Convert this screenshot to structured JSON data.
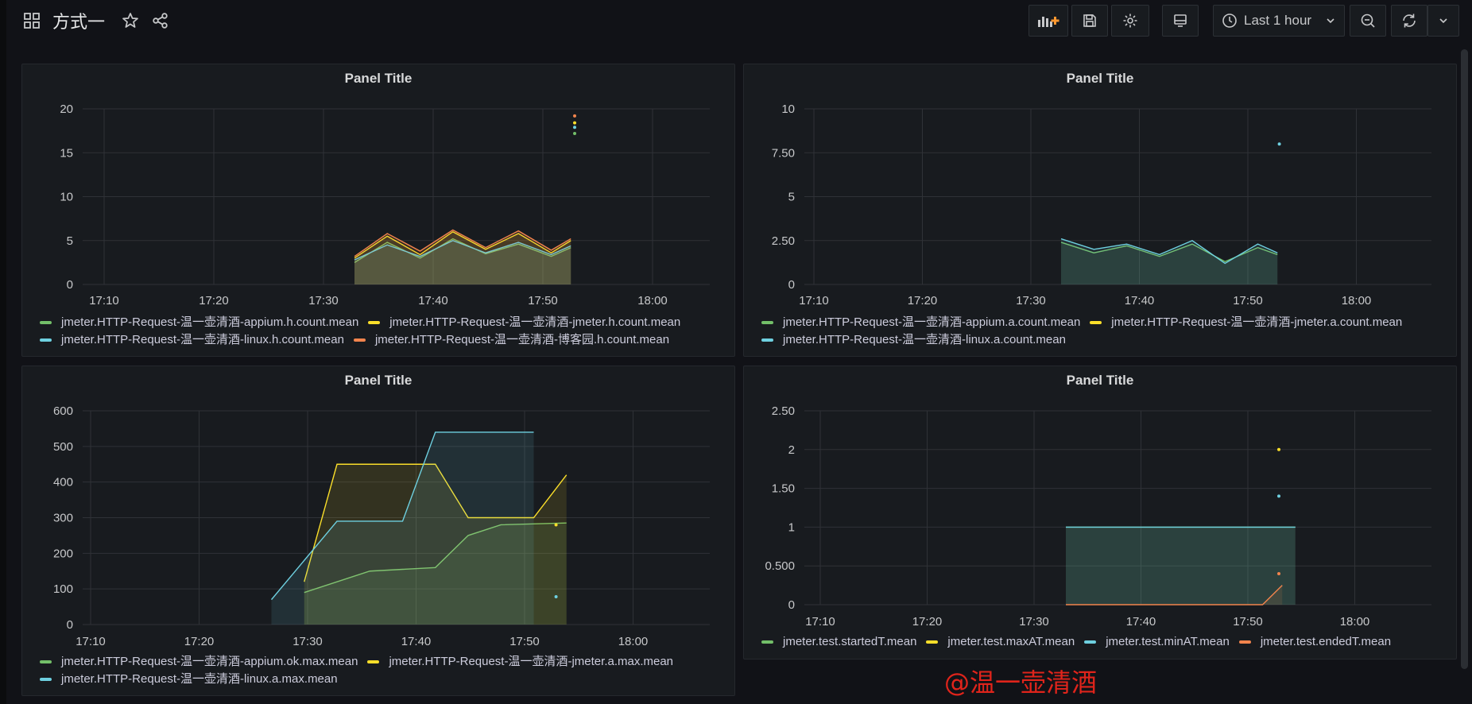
{
  "dashboard": {
    "title": "方式一"
  },
  "toolbar": {
    "time_range": "Last 1 hour",
    "add_panel_icon": "add-panel-icon",
    "save_icon": "save-icon",
    "settings_icon": "gear-icon",
    "tv_icon": "tv-mode-icon",
    "zoom_out_icon": "zoom-out-icon",
    "refresh_icon": "refresh-icon",
    "dropdown_icon": "chevron-down-icon"
  },
  "colors": {
    "green": "#73bf69",
    "yellow": "#fade2a",
    "blue": "#5794f2",
    "cyan": "#6ed0e0",
    "orange": "#ff9830",
    "red_orange": "#f2844d",
    "watermark": "#e0241b"
  },
  "panels": [
    {
      "title": "Panel Title"
    },
    {
      "title": "Panel Title"
    },
    {
      "title": "Panel Title"
    },
    {
      "title": "Panel Title"
    }
  ],
  "chart_data": [
    {
      "type": "line",
      "title": "Panel Title",
      "x_ticks": [
        "17:10",
        "17:20",
        "17:30",
        "17:40",
        "17:50",
        "18:00"
      ],
      "y_ticks": [
        "0",
        "5",
        "10",
        "15",
        "20"
      ],
      "ylim": [
        0,
        20
      ],
      "series": [
        {
          "name": "jmeter.HTTP-Request-温一壶清酒-appium.h.count.mean",
          "color": "#73bf69",
          "points": [
            [
              17.55,
              2.5
            ],
            [
              17.6,
              4.8
            ],
            [
              17.65,
              3
            ],
            [
              17.7,
              5.2
            ],
            [
              17.75,
              3.5
            ],
            [
              17.8,
              4.6
            ],
            [
              17.85,
              3.2
            ],
            [
              17.88,
              4.2
            ]
          ],
          "spot": [
            52.9,
            17.2
          ]
        },
        {
          "name": "jmeter.HTTP-Request-温一壶清酒-jmeter.h.count.mean",
          "color": "#fade2a",
          "points": [
            [
              17.55,
              3
            ],
            [
              17.6,
              5.5
            ],
            [
              17.65,
              3.4
            ],
            [
              17.7,
              6
            ],
            [
              17.75,
              4
            ],
            [
              17.8,
              5.8
            ],
            [
              17.85,
              3.6
            ],
            [
              17.88,
              5
            ]
          ],
          "spot": [
            52.9,
            18.4
          ]
        },
        {
          "name": "jmeter.HTTP-Request-温一壶清酒-linux.h.count.mean",
          "color": "#6ed0e0",
          "points": [
            [
              17.55,
              2.8
            ],
            [
              17.6,
              4.5
            ],
            [
              17.65,
              3.2
            ],
            [
              17.7,
              5
            ],
            [
              17.75,
              3.6
            ],
            [
              17.8,
              4.8
            ],
            [
              17.85,
              3.4
            ],
            [
              17.88,
              4.4
            ]
          ],
          "spot": [
            52.9,
            17.9
          ]
        },
        {
          "name": "jmeter.HTTP-Request-温一壶清酒-博客园.h.count.mean",
          "color": "#f2844d",
          "points": [
            [
              17.55,
              3.2
            ],
            [
              17.6,
              5.8
            ],
            [
              17.65,
              3.8
            ],
            [
              17.7,
              6.2
            ],
            [
              17.75,
              4.2
            ],
            [
              17.8,
              6.1
            ],
            [
              17.85,
              3.9
            ],
            [
              17.88,
              5.2
            ]
          ],
          "spot": [
            52.9,
            19.2
          ]
        }
      ],
      "legend": [
        [
          "jmeter.HTTP-Request-温一壶清酒-appium.h.count.mean",
          "jmeter.HTTP-Request-温一壶清酒-jmeter.h.count.mean"
        ],
        [
          "jmeter.HTTP-Request-温一壶清酒-linux.h.count.mean",
          "jmeter.HTTP-Request-温一壶清酒-博客园.h.count.mean"
        ]
      ]
    },
    {
      "type": "line",
      "title": "Panel Title",
      "x_ticks": [
        "17:10",
        "17:20",
        "17:30",
        "17:40",
        "17:50",
        "18:00"
      ],
      "y_ticks": [
        "0",
        "2.50",
        "5",
        "7.50",
        "10"
      ],
      "ylim": [
        0,
        10
      ],
      "series": [
        {
          "name": "jmeter.HTTP-Request-温一壶清酒-appium.a.count.mean",
          "color": "#73bf69",
          "points": [
            [
              17.55,
              2.4
            ],
            [
              17.6,
              1.8
            ],
            [
              17.65,
              2.2
            ],
            [
              17.7,
              1.6
            ],
            [
              17.75,
              2.3
            ],
            [
              17.8,
              1.3
            ],
            [
              17.85,
              2.1
            ],
            [
              17.88,
              1.7
            ]
          ],
          "spot": null
        },
        {
          "name": "jmeter.HTTP-Request-温一壶清酒-jmeter.a.count.mean",
          "color": "#fade2a",
          "points": [],
          "spot": null
        },
        {
          "name": "jmeter.HTTP-Request-温一壶清酒-linux.a.count.mean",
          "color": "#6ed0e0",
          "points": [
            [
              17.55,
              2.6
            ],
            [
              17.6,
              2
            ],
            [
              17.65,
              2.3
            ],
            [
              17.7,
              1.7
            ],
            [
              17.75,
              2.5
            ],
            [
              17.8,
              1.2
            ],
            [
              17.85,
              2.3
            ],
            [
              17.88,
              1.8
            ]
          ],
          "spot": [
            52.9,
            8
          ]
        }
      ],
      "legend": [
        [
          "jmeter.HTTP-Request-温一壶清酒-appium.a.count.mean",
          "jmeter.HTTP-Request-温一壶清酒-jmeter.a.count.mean"
        ],
        [
          "jmeter.HTTP-Request-温一壶清酒-linux.a.count.mean"
        ]
      ]
    },
    {
      "type": "line",
      "title": "Panel Title",
      "x_ticks": [
        "17:10",
        "17:20",
        "17:30",
        "17:40",
        "17:50",
        "18:00"
      ],
      "y_ticks": [
        "0",
        "100",
        "200",
        "300",
        "400",
        "500",
        "600"
      ],
      "ylim": [
        0,
        600
      ],
      "series": [
        {
          "name": "jmeter.HTTP-Request-温一壶清酒-appium.ok.max.mean",
          "color": "#73bf69",
          "points": [
            [
              17.5,
              90
            ],
            [
              17.6,
              150
            ],
            [
              17.7,
              160
            ],
            [
              17.75,
              250
            ],
            [
              17.8,
              280
            ],
            [
              17.9,
              285
            ]
          ],
          "spot": null
        },
        {
          "name": "jmeter.HTTP-Request-温一壶清酒-jmeter.a.max.mean",
          "color": "#fade2a",
          "points": [
            [
              17.5,
              120
            ],
            [
              17.55,
              450
            ],
            [
              17.7,
              450
            ],
            [
              17.75,
              300
            ],
            [
              17.85,
              300
            ],
            [
              17.9,
              420
            ]
          ],
          "spot": [
            52.9,
            280
          ]
        },
        {
          "name": "jmeter.HTTP-Request-温一壶清酒-linux.a.max.mean",
          "color": "#6ed0e0",
          "points": [
            [
              17.45,
              70
            ],
            [
              17.55,
              290
            ],
            [
              17.65,
              290
            ],
            [
              17.7,
              540
            ],
            [
              17.85,
              540
            ]
          ],
          "spot": [
            52.9,
            78
          ]
        }
      ],
      "legend": [
        [
          "jmeter.HTTP-Request-温一壶清酒-appium.ok.max.mean",
          "jmeter.HTTP-Request-温一壶清酒-jmeter.a.max.mean"
        ],
        [
          "jmeter.HTTP-Request-温一壶清酒-linux.a.max.mean"
        ]
      ]
    },
    {
      "type": "line",
      "title": "Panel Title",
      "x_ticks": [
        "17:10",
        "17:20",
        "17:30",
        "17:40",
        "17:50",
        "18:00"
      ],
      "y_ticks": [
        "0",
        "0.500",
        "1",
        "1.50",
        "2",
        "2.50"
      ],
      "ylim": [
        0,
        2.5
      ],
      "series": [
        {
          "name": "jmeter.test.startedT.mean",
          "color": "#73bf69",
          "points": [
            [
              17.55,
              1
            ],
            [
              17.9,
              1
            ]
          ],
          "spot": null
        },
        {
          "name": "jmeter.test.maxAT.mean",
          "color": "#fade2a",
          "points": [],
          "spot": [
            52.9,
            2
          ]
        },
        {
          "name": "jmeter.test.minAT.mean",
          "color": "#6ed0e0",
          "points": [
            [
              17.55,
              1
            ],
            [
              17.9,
              1
            ]
          ],
          "spot": [
            52.9,
            1.4
          ]
        },
        {
          "name": "jmeter.test.endedT.mean",
          "color": "#f2844d",
          "points": [
            [
              17.55,
              0
            ],
            [
              17.85,
              0
            ],
            [
              17.88,
              0.25
            ]
          ],
          "spot": [
            52.9,
            0.4
          ]
        }
      ],
      "legend": [
        [
          "jmeter.test.startedT.mean",
          "jmeter.test.maxAT.mean",
          "jmeter.test.minAT.mean",
          "jmeter.test.endedT.mean"
        ]
      ]
    }
  ],
  "watermark": "@温一壶清酒"
}
